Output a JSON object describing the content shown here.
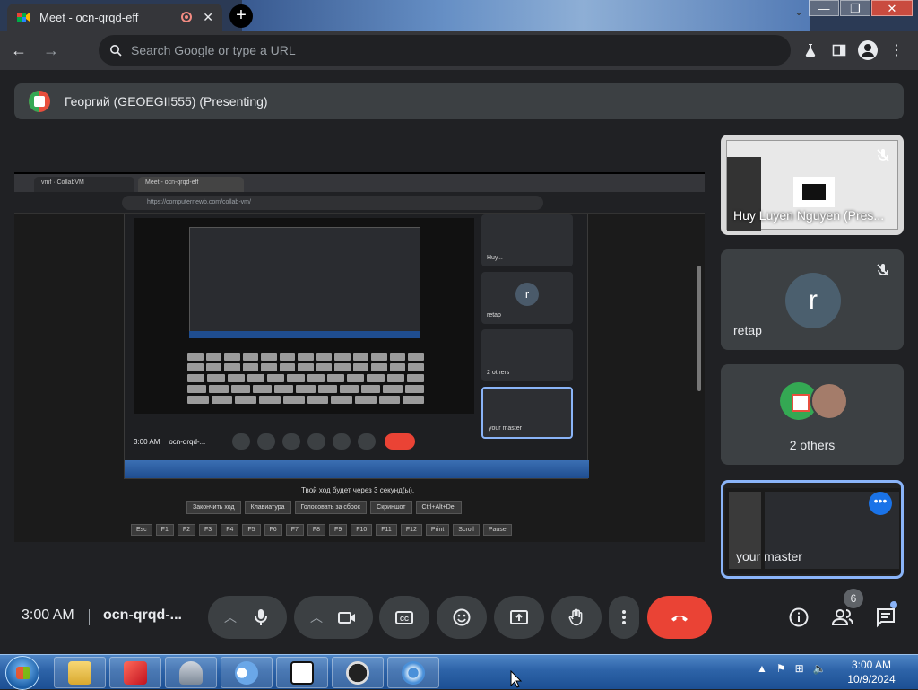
{
  "browser": {
    "tab_title": "Meet - ocn-qrqd-eff",
    "tab_close": "✕",
    "new_tab": "+",
    "omnibox_placeholder": "Search Google or type a URL",
    "window_controls": {
      "minimize": "—",
      "maximize": "❐",
      "close": "✕"
    }
  },
  "presenting_banner": {
    "name": "Георгий (GEOEGII555) (Presenting)"
  },
  "shared_screen": {
    "inner_tab_a": "vmf · CollabVM",
    "inner_tab_b": "Meet - ocn-qrqd-eff",
    "inner_url": "https://computernewb.com/collab-vm/",
    "nested_time": "3:00 AM",
    "nested_code": "ocn-qrqd-...",
    "nested_tiles": [
      {
        "label": "Huy..."
      },
      {
        "label": "retap",
        "initial": "r"
      },
      {
        "label": "2 others"
      },
      {
        "label": "your master"
      }
    ],
    "nested_clock": "3:00 AM\n10/9/2024",
    "turn_text": "Твой ход будет через 3 секунд(ы).",
    "action_buttons": [
      "Закончить ход",
      "Клавиатура",
      "Голосовать за сброс",
      "Скриншот",
      "Ctrl+Alt+Del"
    ],
    "fkeys": [
      "Esc",
      "F1",
      "F2",
      "F3",
      "F4",
      "F5",
      "F6",
      "F7",
      "F8",
      "F9",
      "F10",
      "F11",
      "F12",
      "Print",
      "Scroll",
      "Pause"
    ]
  },
  "participants": [
    {
      "name": "Huy Luyen Nguyen (Pres...",
      "muted": true
    },
    {
      "name": "retap",
      "initial": "r",
      "muted": true
    },
    {
      "name": "2 others"
    },
    {
      "name": "your master"
    }
  ],
  "meeting_bar": {
    "time": "3:00 AM",
    "code": "ocn-qrqd-...",
    "people_count": "6"
  },
  "taskbar": {
    "clock_time": "3:00 AM",
    "clock_date": "10/9/2024"
  },
  "colors": {
    "accent": "#8ab4f8",
    "end_call": "#ea4335",
    "background": "#202124",
    "tile": "#3c4043"
  }
}
